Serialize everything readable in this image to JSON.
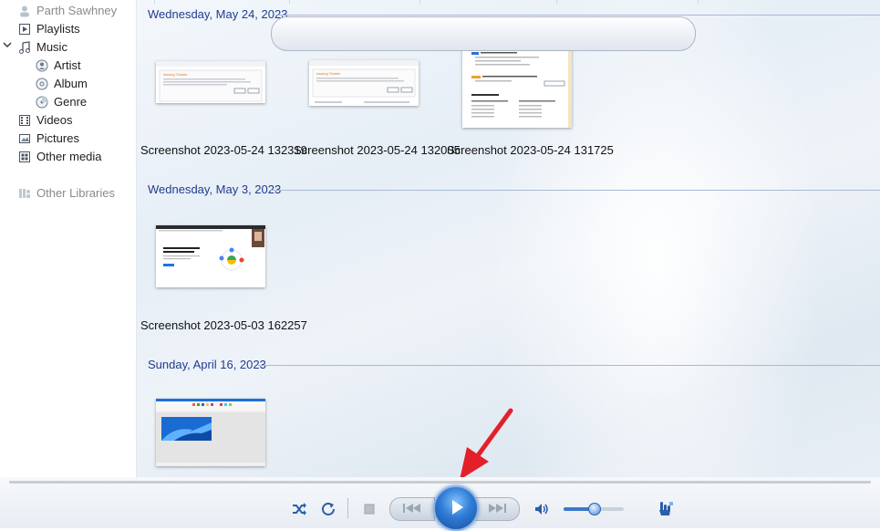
{
  "sidebar": {
    "items": [
      {
        "label": "Parth Sawhney",
        "icon": "person-icon"
      },
      {
        "label": "Playlists",
        "icon": "playlist-icon"
      },
      {
        "label": "Music",
        "icon": "music-note-icon"
      },
      {
        "label": "Artist",
        "icon": "artist-icon"
      },
      {
        "label": "Album",
        "icon": "album-icon"
      },
      {
        "label": "Genre",
        "icon": "genre-icon"
      },
      {
        "label": "Videos",
        "icon": "videos-icon"
      },
      {
        "label": "Pictures",
        "icon": "pictures-icon"
      },
      {
        "label": "Other media",
        "icon": "other-media-icon"
      },
      {
        "label": "Other Libraries",
        "icon": "other-libraries-icon"
      }
    ]
  },
  "groups": [
    {
      "date": "Wednesday, May 24, 2023",
      "items": [
        {
          "caption": "Screenshot 2023-05-24 132319",
          "thumb_title": "Issuing Tickets"
        },
        {
          "caption": "Screenshot 2023-05-24 132005",
          "thumb_title": "Issuing Tickets"
        },
        {
          "caption": "Screenshot 2023-05-24 131725",
          "thumb_title": "Flight Details"
        }
      ]
    },
    {
      "date": "Wednesday, May 3, 2023",
      "items": [
        {
          "caption": "Screenshot 2023-05-03 162257",
          "thumb_title": ""
        }
      ]
    },
    {
      "date": "Sunday, April 16, 2023",
      "items": [
        {
          "caption": "",
          "thumb_title": ""
        }
      ]
    }
  ],
  "player": {
    "volume_level": 0.5,
    "icons": [
      "shuffle-icon",
      "repeat-icon",
      "stop-icon",
      "previous-icon",
      "play-icon",
      "next-icon",
      "volume-icon",
      "switch-to-now-playing-icon"
    ]
  },
  "colors": {
    "group_header": "#1f3c8f",
    "accent_blue": "#2f7bd6",
    "annotation_arrow": "#e3202a"
  }
}
